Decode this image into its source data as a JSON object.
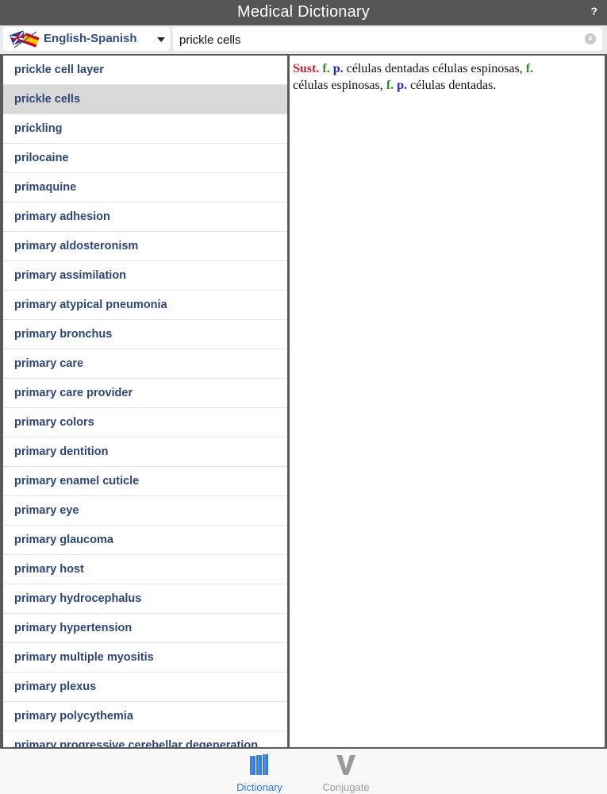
{
  "app": {
    "title": "Medical Dictionary",
    "help": "?"
  },
  "toolbar": {
    "language": "English-Spanish",
    "search_value": "prickle cells"
  },
  "list": {
    "selected_index": 1,
    "items": [
      "prickle cell layer",
      "prickle cells",
      "prickling",
      "prilocaine",
      "primaquine",
      "primary adhesion",
      "primary aldosteronism",
      "primary assimilation",
      "primary atypical pneumonia",
      "primary bronchus",
      "primary care",
      "primary care provider",
      "primary colors",
      "primary dentition",
      "primary enamel cuticle",
      "primary eye",
      "primary glaucoma",
      "primary host",
      "primary hydrocephalus",
      "primary hypertension",
      "primary multiple myositis",
      "primary plexus",
      "primary polycythemia",
      "primary progressive cerebellar degeneration"
    ]
  },
  "definition": {
    "pos": "Sust.",
    "g1": "f.",
    "n1": "p.",
    "t1": " células dentadas células espinosas, ",
    "g2": "f.",
    "t2": " células espinosas, ",
    "g3": "f.",
    "n2": "p.",
    "t3": " células dentadas."
  },
  "tabs": {
    "dictionary": "Dictionary",
    "conjugate": "Conjugate",
    "active_color": "#2a7de1",
    "inactive_color": "#9a9a9a"
  },
  "colors": {
    "pos": "#d0243a",
    "gender": "#2f8a2f",
    "number": "#2424b8"
  }
}
